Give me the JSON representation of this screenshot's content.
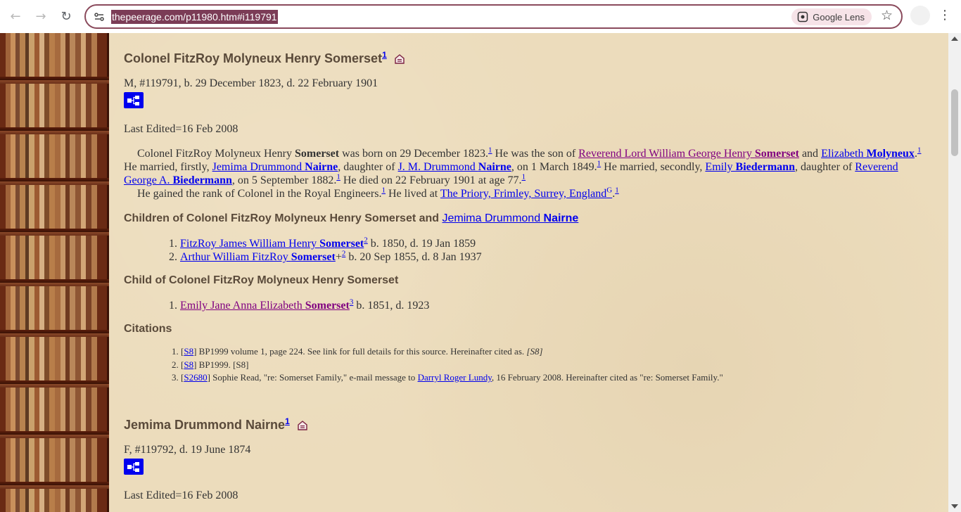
{
  "browser": {
    "url": "thepeerage.com/p11980.htm#i119791",
    "lens_label": "Google Lens"
  },
  "person1": {
    "name": "Colonel FitzRoy Molyneux Henry Somerset",
    "name_sup": "1",
    "info": "M, #119791, b. 29 December 1823, d. 22 February 1901",
    "last_edited": "Last Edited=16 Feb 2008",
    "bio": {
      "s1": "Colonel FitzRoy Molyneux Henry ",
      "s1b": "Somerset",
      "s2": " was born on 29 December 1823.",
      "s3": " He was the son of ",
      "father_pre": "Reverend Lord William George Henry ",
      "father_surname": "Somerset",
      "s4": " and ",
      "mother_pre": "Elizabeth ",
      "mother_surname": "Molyneux",
      "s5": ".",
      "s6": " He married, firstly, ",
      "wife1_pre": "Jemima Drummond ",
      "wife1_surname": "Nairne",
      "s7": ", daughter of ",
      "wife1_father_pre": "J. M. Drummond ",
      "wife1_father_surname": "Nairne",
      "s8": ", on 1 March 1849.",
      "s9": " He married, secondly, ",
      "wife2_pre": "Emily ",
      "wife2_surname": "Biedermann",
      "s10": ", daughter of ",
      "wife2_father_pre": "Reverend George A. ",
      "wife2_father_surname": "Biedermann",
      "s11": ", on 5 September 1882.",
      "s12": " He died on 22 February 1901 at age 77.",
      "s13": "He gained the rank of Colonel in the Royal Engineers.",
      "s14": " He lived at ",
      "residence": "The Priory, Frimley, Surrey, England",
      "residence_sup": "G",
      "s15": ".",
      "sup1": "1"
    },
    "children_heading_pre": "Children of Colonel FitzRoy Molyneux Henry Somerset and ",
    "children_heading_link_pre": "Jemima Drummond ",
    "children_heading_link_surname": "Nairne",
    "children": [
      {
        "pre": "FitzRoy James William Henry ",
        "surname": "Somerset",
        "suffix": "",
        "sup": "2",
        "dates": " b. 1850, d. 19 Jan 1859"
      },
      {
        "pre": "Arthur William FitzRoy ",
        "surname": "Somerset",
        "suffix": "+",
        "sup": "2",
        "dates": " b. 20 Sep 1855, d. 8 Jan 1937"
      }
    ],
    "child_heading": "Child of Colonel FitzRoy Molyneux Henry Somerset",
    "child2": [
      {
        "pre": "Emily Jane Anna Elizabeth ",
        "surname": "Somerset",
        "sup": "3",
        "dates": " b. 1851, d. 1923"
      }
    ],
    "citations_heading": "Citations",
    "citations": [
      {
        "ref": "S8",
        "text": " BP1999 volume 1, page 224. See link for full details for this source. Hereinafter cited as. ",
        "italic": "[S8]"
      },
      {
        "ref": "S8",
        "text": " BP1999. [S8]"
      },
      {
        "ref": "S2680",
        "text_pre": " Sophie Read, \"re: Somerset Family,\" e-mail message to ",
        "link": "Darryl Roger Lundy",
        "text_post": ", 16 February 2008. Hereinafter cited as \"re: Somerset Family.\""
      }
    ]
  },
  "person2": {
    "name": "Jemima Drummond Nairne",
    "name_sup": "1",
    "info": "F, #119792, d. 19 June 1874",
    "last_edited": "Last Edited=16 Feb 2008"
  },
  "colors": {
    "link": "#0000ee",
    "visited_link": "#800080",
    "heading": "#5a4a3a",
    "page_bg": "#ecdcbc"
  },
  "icons": [
    "back-arrow-icon",
    "forward-arrow-icon",
    "reload-icon",
    "site-settings-icon",
    "google-lens-icon",
    "bookmark-star-icon",
    "kebab-menu-icon",
    "family-tree-icon",
    "house-icon"
  ]
}
